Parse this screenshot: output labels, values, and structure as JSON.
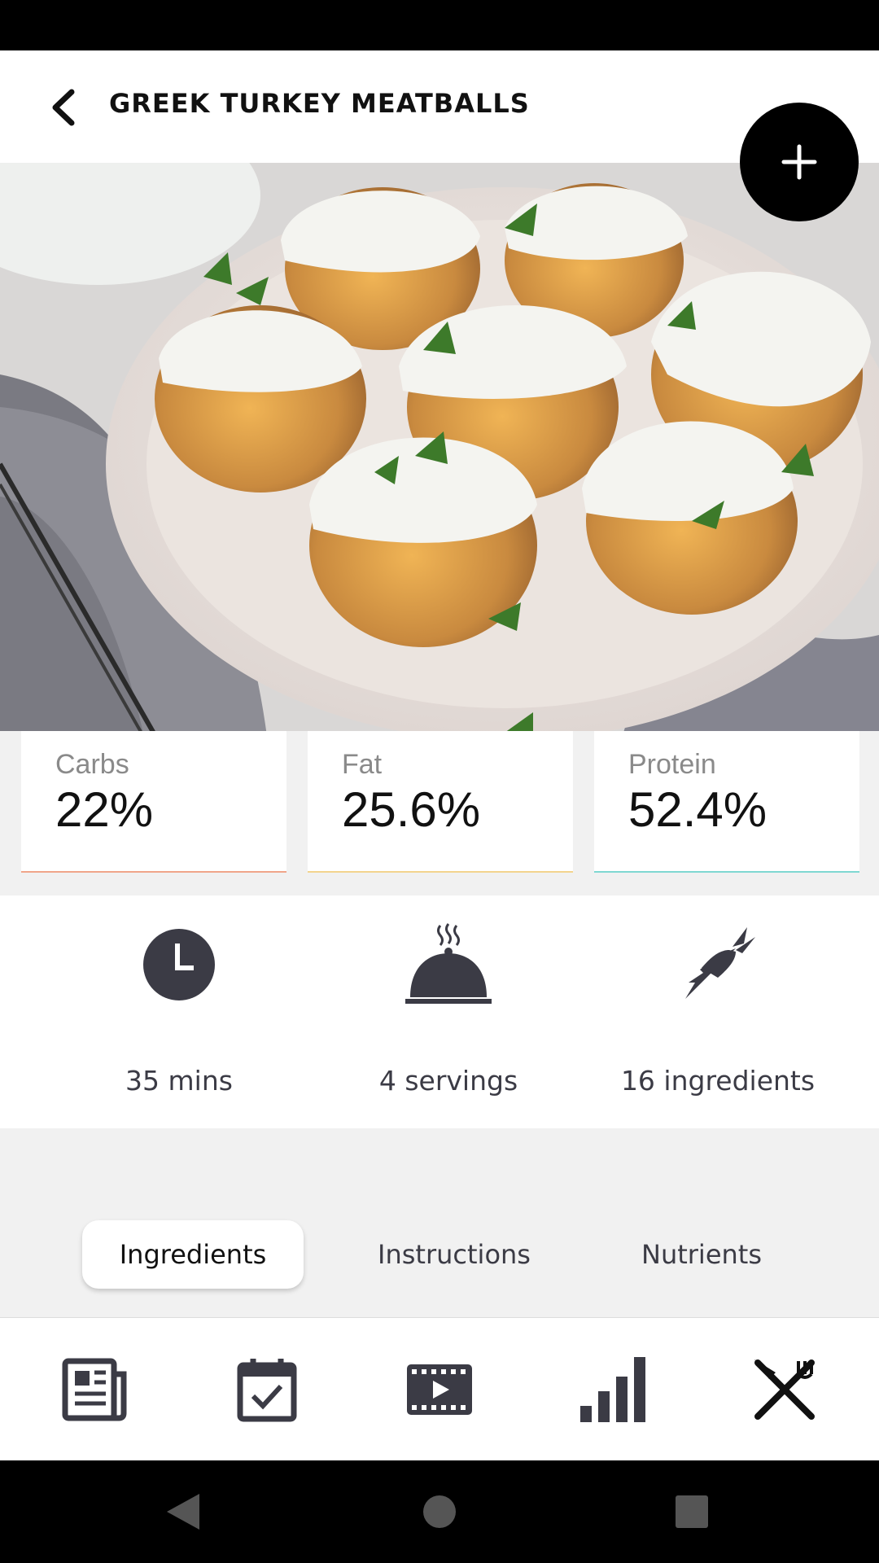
{
  "header": {
    "title": "GREEK TURKEY MEATBALLS",
    "back_icon": "chevron-left-icon",
    "add_icon": "plus-icon"
  },
  "macros": [
    {
      "label": "Carbs",
      "value": "22%",
      "color": "#f0a58a"
    },
    {
      "label": "Fat",
      "value": "25.6%",
      "color": "#f3d48e"
    },
    {
      "label": "Protein",
      "value": "52.4%",
      "color": "#7fd8d2"
    }
  ],
  "info": {
    "time": "35 mins",
    "servings": "4 servings",
    "ingredients": "16 ingredients"
  },
  "tabs": [
    {
      "label": "Ingredients",
      "active": true
    },
    {
      "label": "Instructions",
      "active": false
    },
    {
      "label": "Nutrients",
      "active": false
    }
  ],
  "bottom_nav": [
    "news-icon",
    "calendar-check-icon",
    "video-icon",
    "bar-chart-icon",
    "fork-knife-icon"
  ],
  "colors": {
    "icon_dark": "#3b3b45",
    "background": "#f1f1f1"
  }
}
